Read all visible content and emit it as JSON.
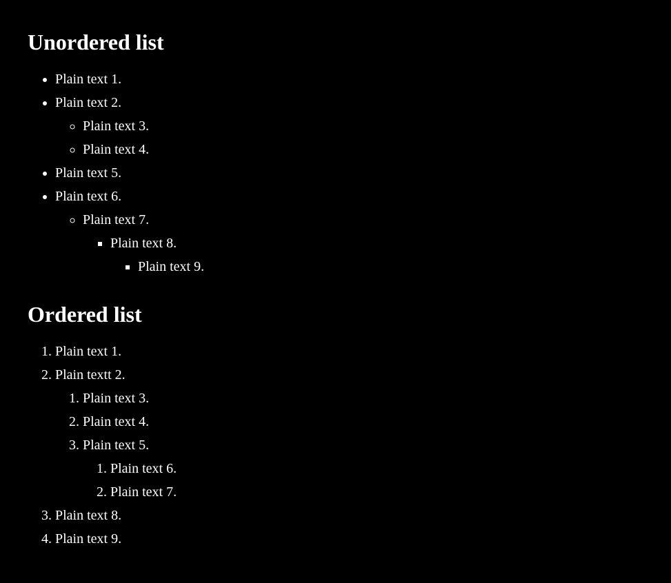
{
  "headings": {
    "unordered": "Unordered list",
    "ordered": "Ordered list"
  },
  "unordered": {
    "i1": "Plain text 1.",
    "i2": "Plain text 2.",
    "i3": "Plain text 3.",
    "i4": "Plain text 4.",
    "i5": "Plain text 5.",
    "i6": "Plain text 6.",
    "i7": "Plain text 7.",
    "i8": "Plain text 8.",
    "i9": "Plain text 9."
  },
  "ordered": {
    "i1": "Plain text 1.",
    "i2": "Plain textt 2.",
    "i3": "Plain text 3.",
    "i4": "Plain text 4.",
    "i5": "Plain text 5.",
    "i6": "Plain text 6.",
    "i7": "Plain text 7.",
    "i8": "Plain text 8.",
    "i9": "Plain text 9."
  }
}
